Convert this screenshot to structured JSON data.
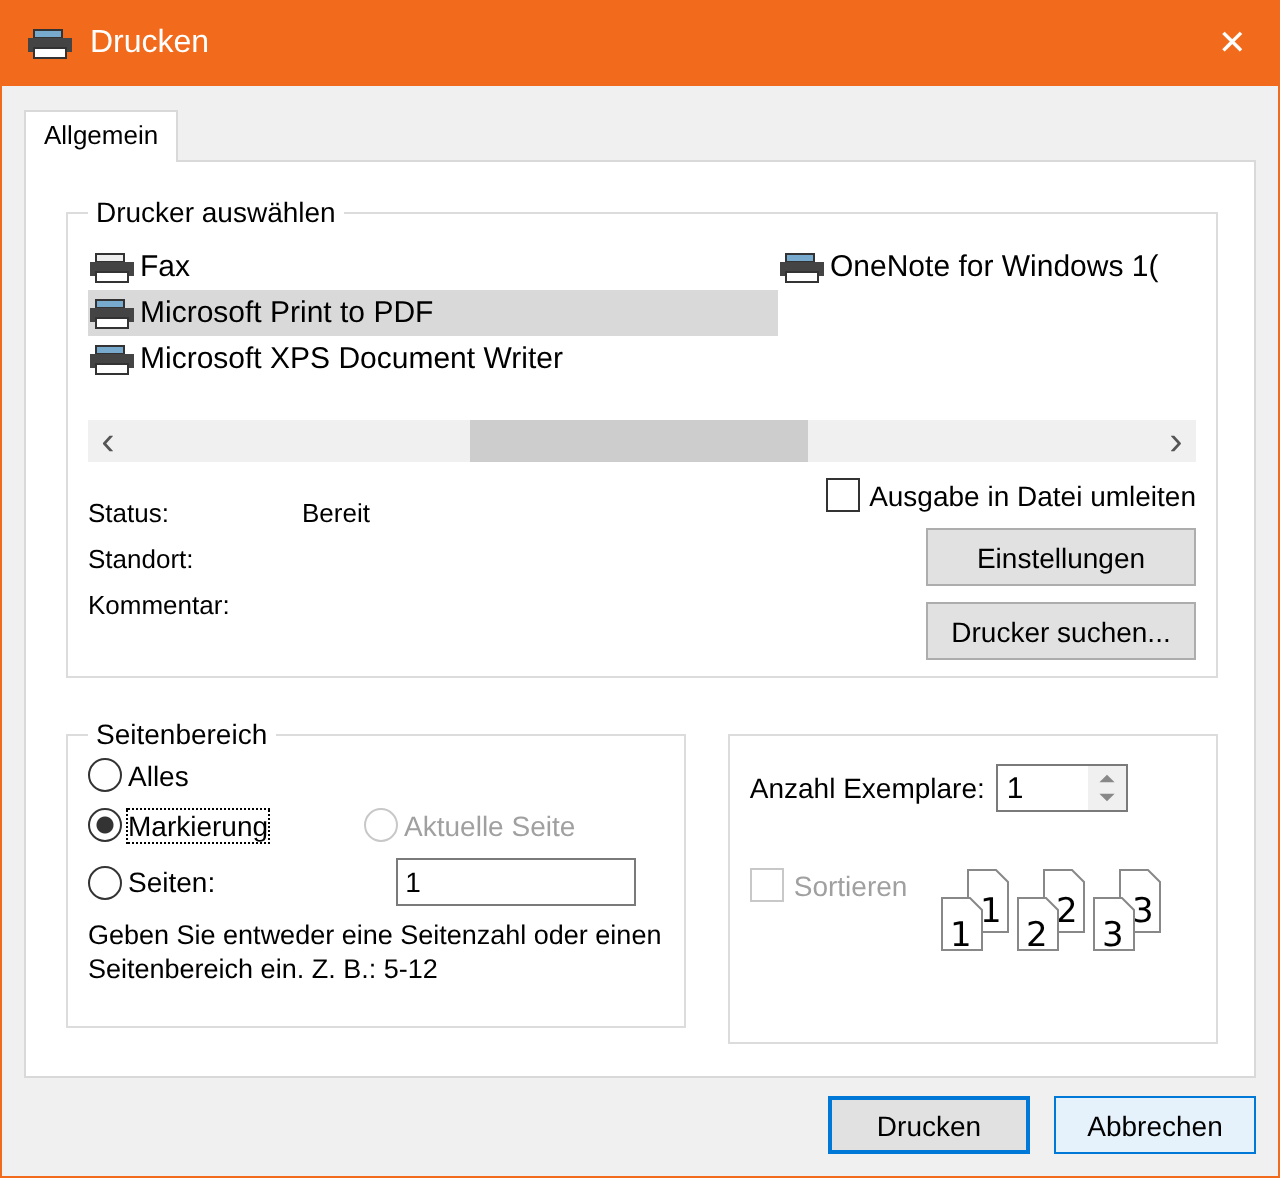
{
  "window": {
    "title": "Drucken",
    "close": "✕"
  },
  "tabs": [
    {
      "label": "Allgemein",
      "selected": true
    }
  ],
  "printer_group": {
    "title": "Drucker auswählen",
    "printers": [
      {
        "name": "Fax",
        "kind": "fax",
        "selected": false
      },
      {
        "name": "Microsoft Print to PDF",
        "kind": "printer",
        "selected": true
      },
      {
        "name": "Microsoft XPS Document Writer",
        "kind": "printer",
        "selected": false
      },
      {
        "name": "OneNote for Windows 1(",
        "kind": "printer",
        "selected": false
      }
    ],
    "scrollbar": {
      "left": "‹",
      "right": "›"
    },
    "info": [
      {
        "label": "Status:",
        "value": "Bereit"
      },
      {
        "label": "Standort:"
      },
      {
        "label": "Kommentar:"
      }
    ],
    "redirect": {
      "label": "Ausgabe in Datei umleiten",
      "checked": false
    },
    "buttons": [
      "Einstellungen",
      "Drucker suchen..."
    ]
  },
  "range_group": {
    "title": "Seitenbereich",
    "options": [
      {
        "label": "Alles",
        "selected": false,
        "disabled": false
      },
      {
        "label": "Markierung",
        "selected": true,
        "disabled": false
      },
      {
        "label": "Aktuelle Seite",
        "selected": false,
        "disabled": true
      },
      {
        "label": "Seiten:",
        "selected": false,
        "disabled": false
      }
    ],
    "pages_value": "1",
    "hint": "Geben Sie entweder eine Seitenzahl oder einen Seitenbereich ein. Z. B.: 5-12"
  },
  "copies_group": {
    "label": "Anzahl Exemplare:",
    "value": "1",
    "collate": {
      "label": "Sortieren",
      "checked": false,
      "disabled": true
    },
    "collate_pages": [
      {
        "front": "1",
        "back": "1"
      },
      {
        "front": "2",
        "back": "2"
      },
      {
        "front": "3",
        "back": "3"
      }
    ]
  },
  "buttons": [
    {
      "label": "Drucken",
      "default": true
    },
    {
      "label": "Abbrechen",
      "default": false
    }
  ]
}
